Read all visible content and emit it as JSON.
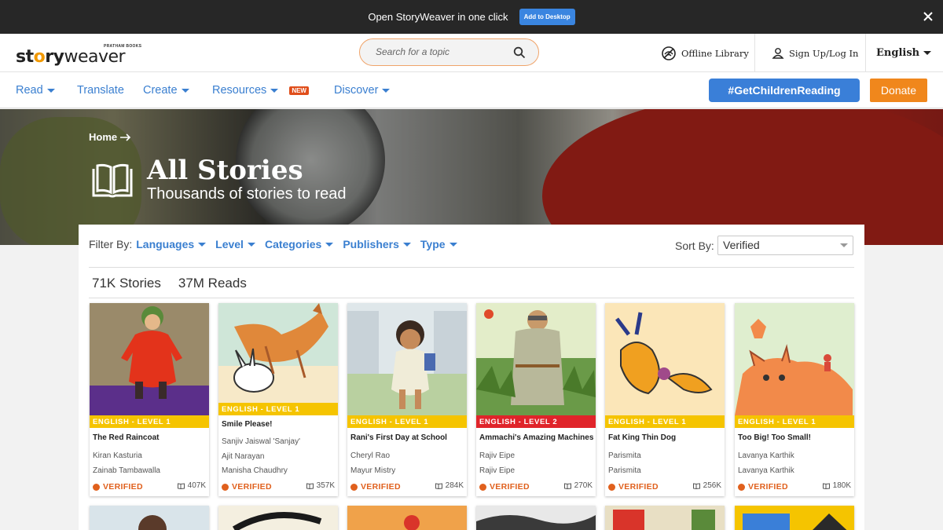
{
  "banner": {
    "message": "Open StoryWeaver in one click",
    "button": "Add to Desktop"
  },
  "header": {
    "logo_publisher": "PRATHAM BOOKS",
    "logo_word_1": "st",
    "logo_word_2": "o",
    "logo_word_3": "ry",
    "logo_word_4": "weaver",
    "search_placeholder": "Search for a topic",
    "offline_library": "Offline Library",
    "signup": "Sign Up/Log In",
    "language": "English"
  },
  "nav": {
    "read": "Read",
    "translate": "Translate",
    "create": "Create",
    "resources": "Resources",
    "new_badge": "NEW",
    "discover": "Discover",
    "get_children_reading": "#GetChildrenReading",
    "donate": "Donate"
  },
  "hero": {
    "breadcrumb": "Home",
    "title": "All Stories",
    "subtitle": "Thousands of stories to read"
  },
  "filters": {
    "label": "Filter By:",
    "items": [
      "Languages",
      "Level",
      "Categories",
      "Publishers",
      "Type"
    ],
    "sort_label": "Sort By:",
    "sort_value": "Verified"
  },
  "stats": {
    "stories": "71K Stories",
    "reads": "37M Reads"
  },
  "verified_label": "VERIFIED",
  "colors": {
    "level1": "#f5c400",
    "level2": "#e0242a",
    "accent_blue": "#3a7fd0",
    "accent_orange": "#f0871c"
  },
  "cards": [
    {
      "level": "ENGLISH - LEVEL 1",
      "title": "The Red Raincoat",
      "author": "Kiran Kasturia",
      "illustrator": "Zainab Tambawalla",
      "reads": "407K"
    },
    {
      "level": "ENGLISH - LEVEL 1",
      "title": "Smile Please!",
      "author": "Sanjiv Jaiswal 'Sanjay'",
      "illustrator": "Ajit Narayan",
      "illustrator2": "Manisha Chaudhry",
      "reads": "357K"
    },
    {
      "level": "ENGLISH - LEVEL 1",
      "title": "Rani's First Day at School",
      "author": "Cheryl Rao",
      "illustrator": "Mayur Mistry",
      "reads": "284K"
    },
    {
      "level": "ENGLISH - LEVEL 2",
      "title": "Ammachi's Amazing Machines",
      "author": "Rajiv Eipe",
      "illustrator": "Rajiv Eipe",
      "reads": "270K"
    },
    {
      "level": "ENGLISH - LEVEL 1",
      "title": "Fat King Thin Dog",
      "author": "Parismita",
      "illustrator": "Parismita",
      "reads": "256K"
    },
    {
      "level": "ENGLISH - LEVEL 1",
      "title": "Too Big! Too Small!",
      "author": "Lavanya Karthik",
      "illustrator": "Lavanya Karthik",
      "reads": "180K"
    }
  ]
}
